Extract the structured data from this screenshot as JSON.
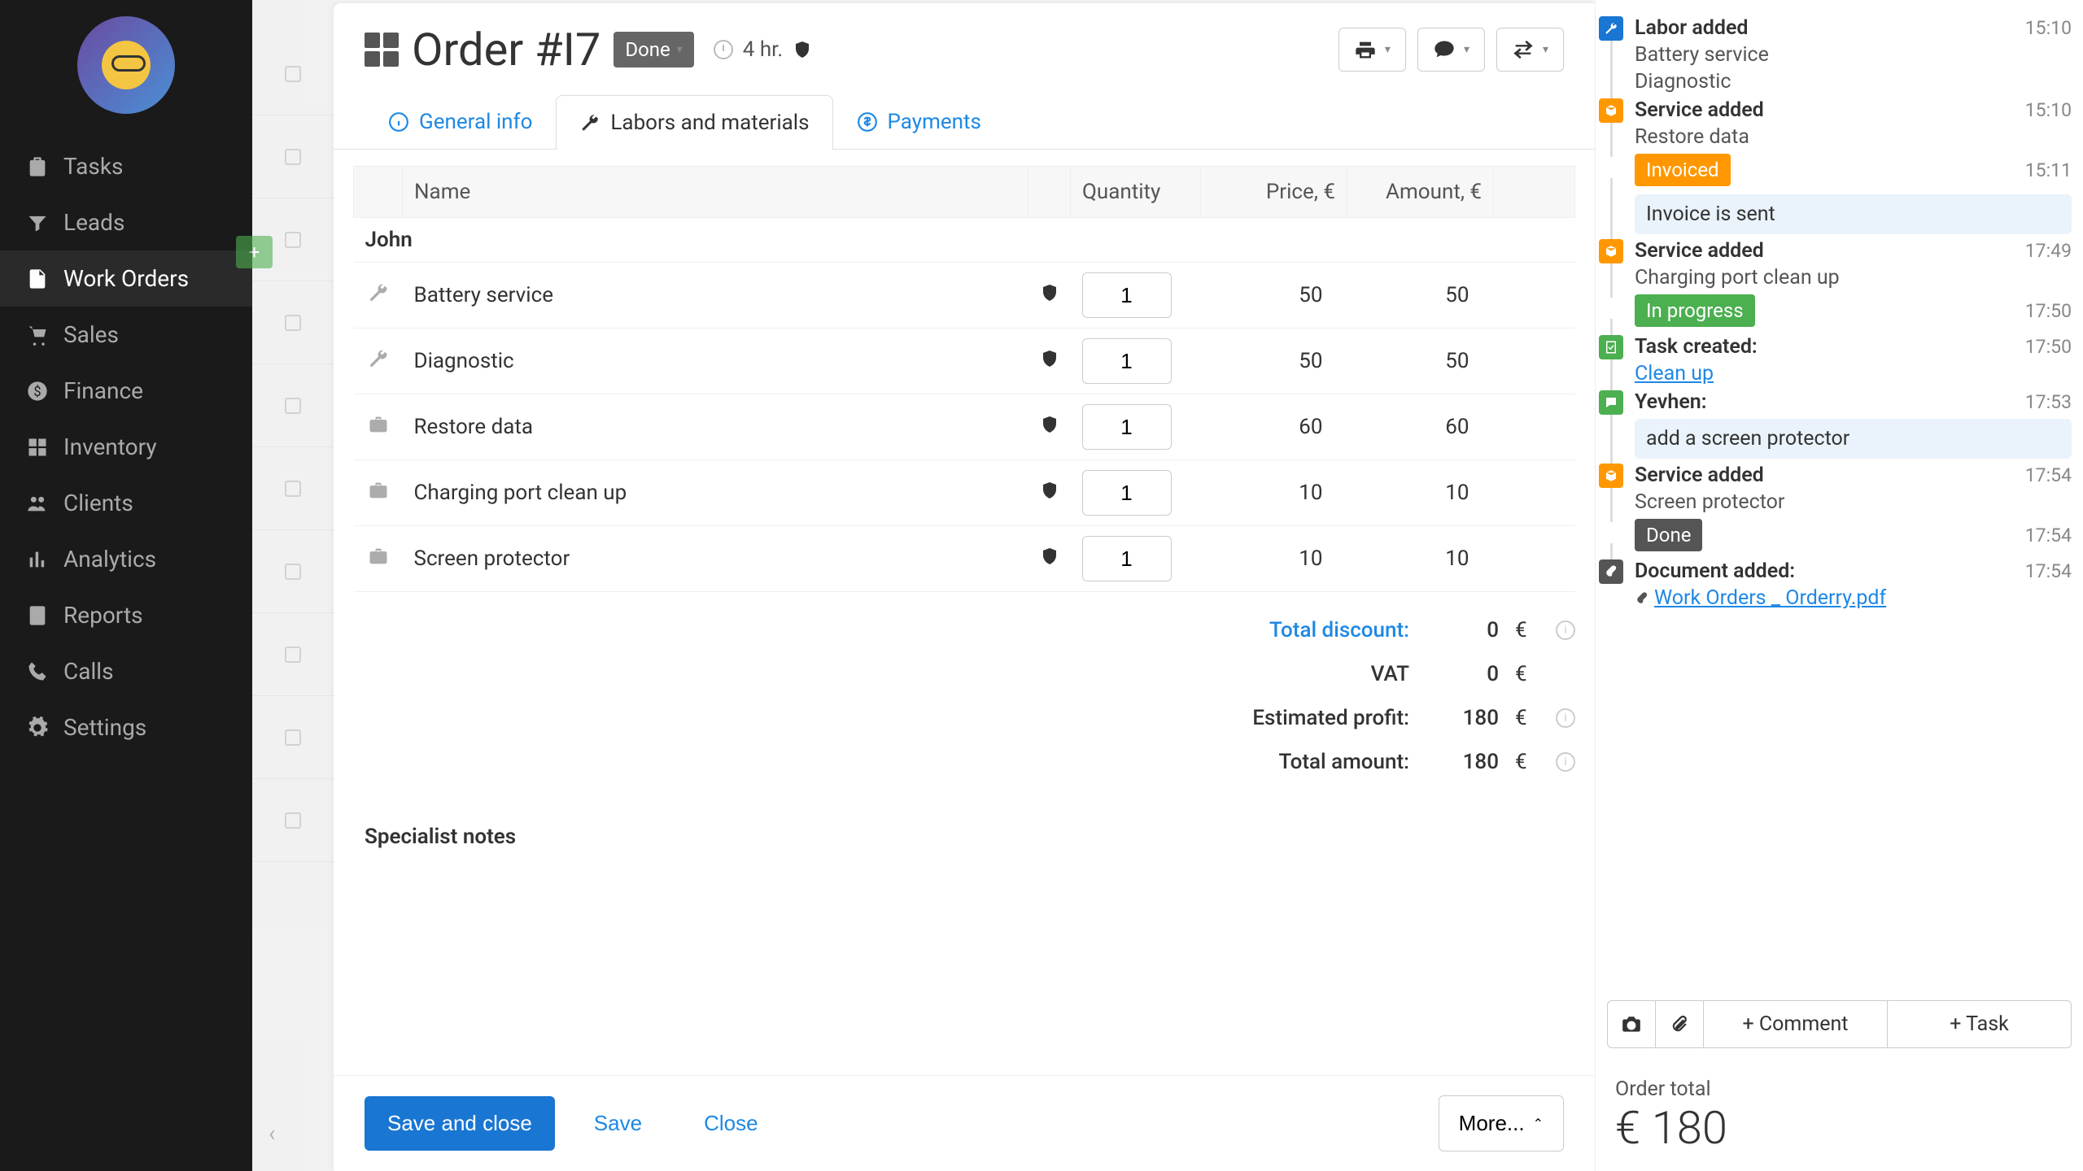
{
  "sidebar": {
    "items": [
      {
        "label": "Tasks",
        "icon": "clipboard"
      },
      {
        "label": "Leads",
        "icon": "filter"
      },
      {
        "label": "Work Orders",
        "icon": "document",
        "active": true
      },
      {
        "label": "Sales",
        "icon": "cart"
      },
      {
        "label": "Finance",
        "icon": "dollar"
      },
      {
        "label": "Inventory",
        "icon": "boxes"
      },
      {
        "label": "Clients",
        "icon": "people"
      },
      {
        "label": "Analytics",
        "icon": "chart"
      },
      {
        "label": "Reports",
        "icon": "report"
      },
      {
        "label": "Calls",
        "icon": "phone"
      },
      {
        "label": "Settings",
        "icon": "gear"
      }
    ]
  },
  "header": {
    "title": "Order #I7",
    "status": "Done",
    "duration": "4 hr."
  },
  "tabs": [
    {
      "label": "General info",
      "icon": "info"
    },
    {
      "label": "Labors and materials",
      "icon": "wrench",
      "active": true
    },
    {
      "label": "Payments",
      "icon": "dollar"
    }
  ],
  "table": {
    "headers": {
      "name": "Name",
      "qty": "Quantity",
      "price": "Price, €",
      "amount": "Amount, €"
    },
    "group": "John",
    "rows": [
      {
        "icon": "wrench",
        "name": "Battery service",
        "qty": "1",
        "price": "50",
        "amount": "50"
      },
      {
        "icon": "wrench",
        "name": "Diagnostic",
        "qty": "1",
        "price": "50",
        "amount": "50"
      },
      {
        "icon": "briefcase",
        "name": "Restore data",
        "qty": "1",
        "price": "60",
        "amount": "60"
      },
      {
        "icon": "briefcase",
        "name": "Charging port clean up",
        "qty": "1",
        "price": "10",
        "amount": "10"
      },
      {
        "icon": "briefcase",
        "name": "Screen protector",
        "qty": "1",
        "price": "10",
        "amount": "10"
      }
    ]
  },
  "totals": {
    "discount_label": "Total discount:",
    "discount": "0",
    "vat_label": "VAT",
    "vat": "0",
    "profit_label": "Estimated profit:",
    "profit": "180",
    "amount_label": "Total amount:",
    "amount": "180",
    "currency": "€"
  },
  "notes_label": "Specialist notes",
  "footer": {
    "save_close": "Save and close",
    "save": "Save",
    "close": "Close",
    "more": "More..."
  },
  "timeline": [
    {
      "type": "event",
      "icon": "wrench",
      "color": "#1976d2",
      "title": "Labor added",
      "time": "15:10",
      "lines": [
        "Battery service",
        "Diagnostic"
      ]
    },
    {
      "type": "event",
      "icon": "box",
      "color": "#ff9800",
      "title": "Service added",
      "time": "15:10",
      "lines": [
        "Restore data"
      ]
    },
    {
      "type": "status",
      "label": "Invoiced",
      "color": "#ff9800",
      "time": "15:11",
      "bubble": "Invoice is sent"
    },
    {
      "type": "event",
      "icon": "box",
      "color": "#ff9800",
      "title": "Service added",
      "time": "17:49",
      "lines": [
        "Charging port clean up"
      ]
    },
    {
      "type": "status",
      "label": "In progress",
      "color": "#4caf50",
      "time": "17:50"
    },
    {
      "type": "event",
      "icon": "check",
      "color": "#4caf50",
      "title": "Task created:",
      "time": "17:50",
      "link": "Clean up"
    },
    {
      "type": "event",
      "icon": "comment",
      "color": "#4caf50",
      "title": "Yevhen:",
      "time": "17:53",
      "bubble": "add a screen protector"
    },
    {
      "type": "event",
      "icon": "box",
      "color": "#ff9800",
      "title": "Service added",
      "time": "17:54",
      "lines": [
        "Screen protector"
      ]
    },
    {
      "type": "status",
      "label": "Done",
      "color": "#555",
      "time": "17:54"
    },
    {
      "type": "event",
      "icon": "attach",
      "color": "#555",
      "title": "Document added:",
      "time": "17:54",
      "link": "Work Orders _ Orderry.pdf",
      "link_icon": true
    }
  ],
  "actions": {
    "comment": "+ Comment",
    "task": "+ Task"
  },
  "order_total": {
    "label": "Order total",
    "value": "€ 180"
  }
}
